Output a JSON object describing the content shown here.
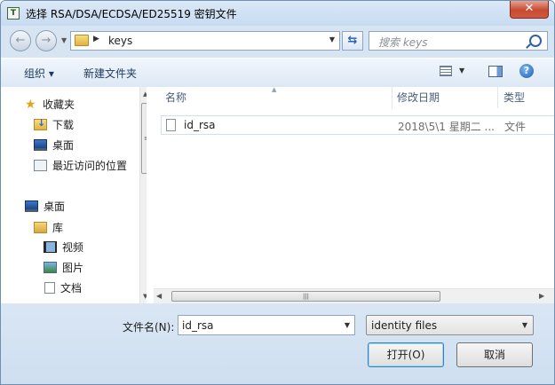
{
  "window": {
    "title": "选择 RSA/DSA/ECDSA/ED25519 密钥文件",
    "title_icon_text": "T",
    "close_label": "✕"
  },
  "nav": {
    "back_glyph": "←",
    "forward_glyph": "→",
    "address_path": "keys",
    "search_placeholder": "搜索 keys"
  },
  "toolbar": {
    "organize_label": "组织 ▾",
    "new_folder_label": "新建文件夹"
  },
  "sidebar": {
    "favorites_label": "收藏夹",
    "downloads_label": "下载",
    "desktop_label": "桌面",
    "recent_label": "最近访问的位置",
    "desktop2_label": "桌面",
    "libraries_label": "库",
    "video_label": "视频",
    "pictures_label": "图片",
    "documents_label": "文档"
  },
  "file_list": {
    "columns": {
      "name": "名称",
      "modified": "修改日期",
      "type": "类型"
    },
    "rows": [
      {
        "name": "id_rsa",
        "modified": "2018\\5\\1 星期二 ...",
        "type": "文件"
      }
    ]
  },
  "footer": {
    "filename_label": "文件名(N):",
    "filename_value": "id_rsa",
    "filter_value": "identity files",
    "open_label": "打开(O)",
    "cancel_label": "取消"
  },
  "icons": {
    "close": "close-icon",
    "back": "back-arrow-icon",
    "forward": "forward-arrow-icon",
    "refresh": "refresh-icon",
    "search": "search-icon",
    "help": "help-icon"
  }
}
